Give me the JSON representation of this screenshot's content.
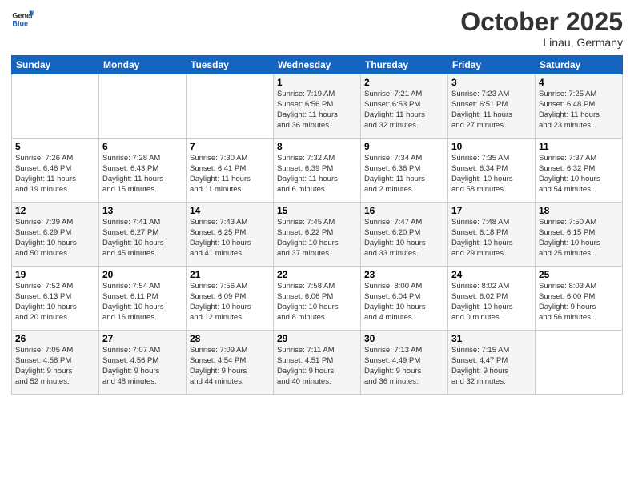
{
  "header": {
    "logo_general": "General",
    "logo_blue": "Blue",
    "month": "October 2025",
    "location": "Linau, Germany"
  },
  "columns": [
    "Sunday",
    "Monday",
    "Tuesday",
    "Wednesday",
    "Thursday",
    "Friday",
    "Saturday"
  ],
  "weeks": [
    [
      {
        "date": "",
        "info": ""
      },
      {
        "date": "",
        "info": ""
      },
      {
        "date": "",
        "info": ""
      },
      {
        "date": "1",
        "info": "Sunrise: 7:19 AM\nSunset: 6:56 PM\nDaylight: 11 hours\nand 36 minutes."
      },
      {
        "date": "2",
        "info": "Sunrise: 7:21 AM\nSunset: 6:53 PM\nDaylight: 11 hours\nand 32 minutes."
      },
      {
        "date": "3",
        "info": "Sunrise: 7:23 AM\nSunset: 6:51 PM\nDaylight: 11 hours\nand 27 minutes."
      },
      {
        "date": "4",
        "info": "Sunrise: 7:25 AM\nSunset: 6:48 PM\nDaylight: 11 hours\nand 23 minutes."
      }
    ],
    [
      {
        "date": "5",
        "info": "Sunrise: 7:26 AM\nSunset: 6:46 PM\nDaylight: 11 hours\nand 19 minutes."
      },
      {
        "date": "6",
        "info": "Sunrise: 7:28 AM\nSunset: 6:43 PM\nDaylight: 11 hours\nand 15 minutes."
      },
      {
        "date": "7",
        "info": "Sunrise: 7:30 AM\nSunset: 6:41 PM\nDaylight: 11 hours\nand 11 minutes."
      },
      {
        "date": "8",
        "info": "Sunrise: 7:32 AM\nSunset: 6:39 PM\nDaylight: 11 hours\nand 6 minutes."
      },
      {
        "date": "9",
        "info": "Sunrise: 7:34 AM\nSunset: 6:36 PM\nDaylight: 11 hours\nand 2 minutes."
      },
      {
        "date": "10",
        "info": "Sunrise: 7:35 AM\nSunset: 6:34 PM\nDaylight: 10 hours\nand 58 minutes."
      },
      {
        "date": "11",
        "info": "Sunrise: 7:37 AM\nSunset: 6:32 PM\nDaylight: 10 hours\nand 54 minutes."
      }
    ],
    [
      {
        "date": "12",
        "info": "Sunrise: 7:39 AM\nSunset: 6:29 PM\nDaylight: 10 hours\nand 50 minutes."
      },
      {
        "date": "13",
        "info": "Sunrise: 7:41 AM\nSunset: 6:27 PM\nDaylight: 10 hours\nand 45 minutes."
      },
      {
        "date": "14",
        "info": "Sunrise: 7:43 AM\nSunset: 6:25 PM\nDaylight: 10 hours\nand 41 minutes."
      },
      {
        "date": "15",
        "info": "Sunrise: 7:45 AM\nSunset: 6:22 PM\nDaylight: 10 hours\nand 37 minutes."
      },
      {
        "date": "16",
        "info": "Sunrise: 7:47 AM\nSunset: 6:20 PM\nDaylight: 10 hours\nand 33 minutes."
      },
      {
        "date": "17",
        "info": "Sunrise: 7:48 AM\nSunset: 6:18 PM\nDaylight: 10 hours\nand 29 minutes."
      },
      {
        "date": "18",
        "info": "Sunrise: 7:50 AM\nSunset: 6:15 PM\nDaylight: 10 hours\nand 25 minutes."
      }
    ],
    [
      {
        "date": "19",
        "info": "Sunrise: 7:52 AM\nSunset: 6:13 PM\nDaylight: 10 hours\nand 20 minutes."
      },
      {
        "date": "20",
        "info": "Sunrise: 7:54 AM\nSunset: 6:11 PM\nDaylight: 10 hours\nand 16 minutes."
      },
      {
        "date": "21",
        "info": "Sunrise: 7:56 AM\nSunset: 6:09 PM\nDaylight: 10 hours\nand 12 minutes."
      },
      {
        "date": "22",
        "info": "Sunrise: 7:58 AM\nSunset: 6:06 PM\nDaylight: 10 hours\nand 8 minutes."
      },
      {
        "date": "23",
        "info": "Sunrise: 8:00 AM\nSunset: 6:04 PM\nDaylight: 10 hours\nand 4 minutes."
      },
      {
        "date": "24",
        "info": "Sunrise: 8:02 AM\nSunset: 6:02 PM\nDaylight: 10 hours\nand 0 minutes."
      },
      {
        "date": "25",
        "info": "Sunrise: 8:03 AM\nSunset: 6:00 PM\nDaylight: 9 hours\nand 56 minutes."
      }
    ],
    [
      {
        "date": "26",
        "info": "Sunrise: 7:05 AM\nSunset: 4:58 PM\nDaylight: 9 hours\nand 52 minutes."
      },
      {
        "date": "27",
        "info": "Sunrise: 7:07 AM\nSunset: 4:56 PM\nDaylight: 9 hours\nand 48 minutes."
      },
      {
        "date": "28",
        "info": "Sunrise: 7:09 AM\nSunset: 4:54 PM\nDaylight: 9 hours\nand 44 minutes."
      },
      {
        "date": "29",
        "info": "Sunrise: 7:11 AM\nSunset: 4:51 PM\nDaylight: 9 hours\nand 40 minutes."
      },
      {
        "date": "30",
        "info": "Sunrise: 7:13 AM\nSunset: 4:49 PM\nDaylight: 9 hours\nand 36 minutes."
      },
      {
        "date": "31",
        "info": "Sunrise: 7:15 AM\nSunset: 4:47 PM\nDaylight: 9 hours\nand 32 minutes."
      },
      {
        "date": "",
        "info": ""
      }
    ]
  ]
}
